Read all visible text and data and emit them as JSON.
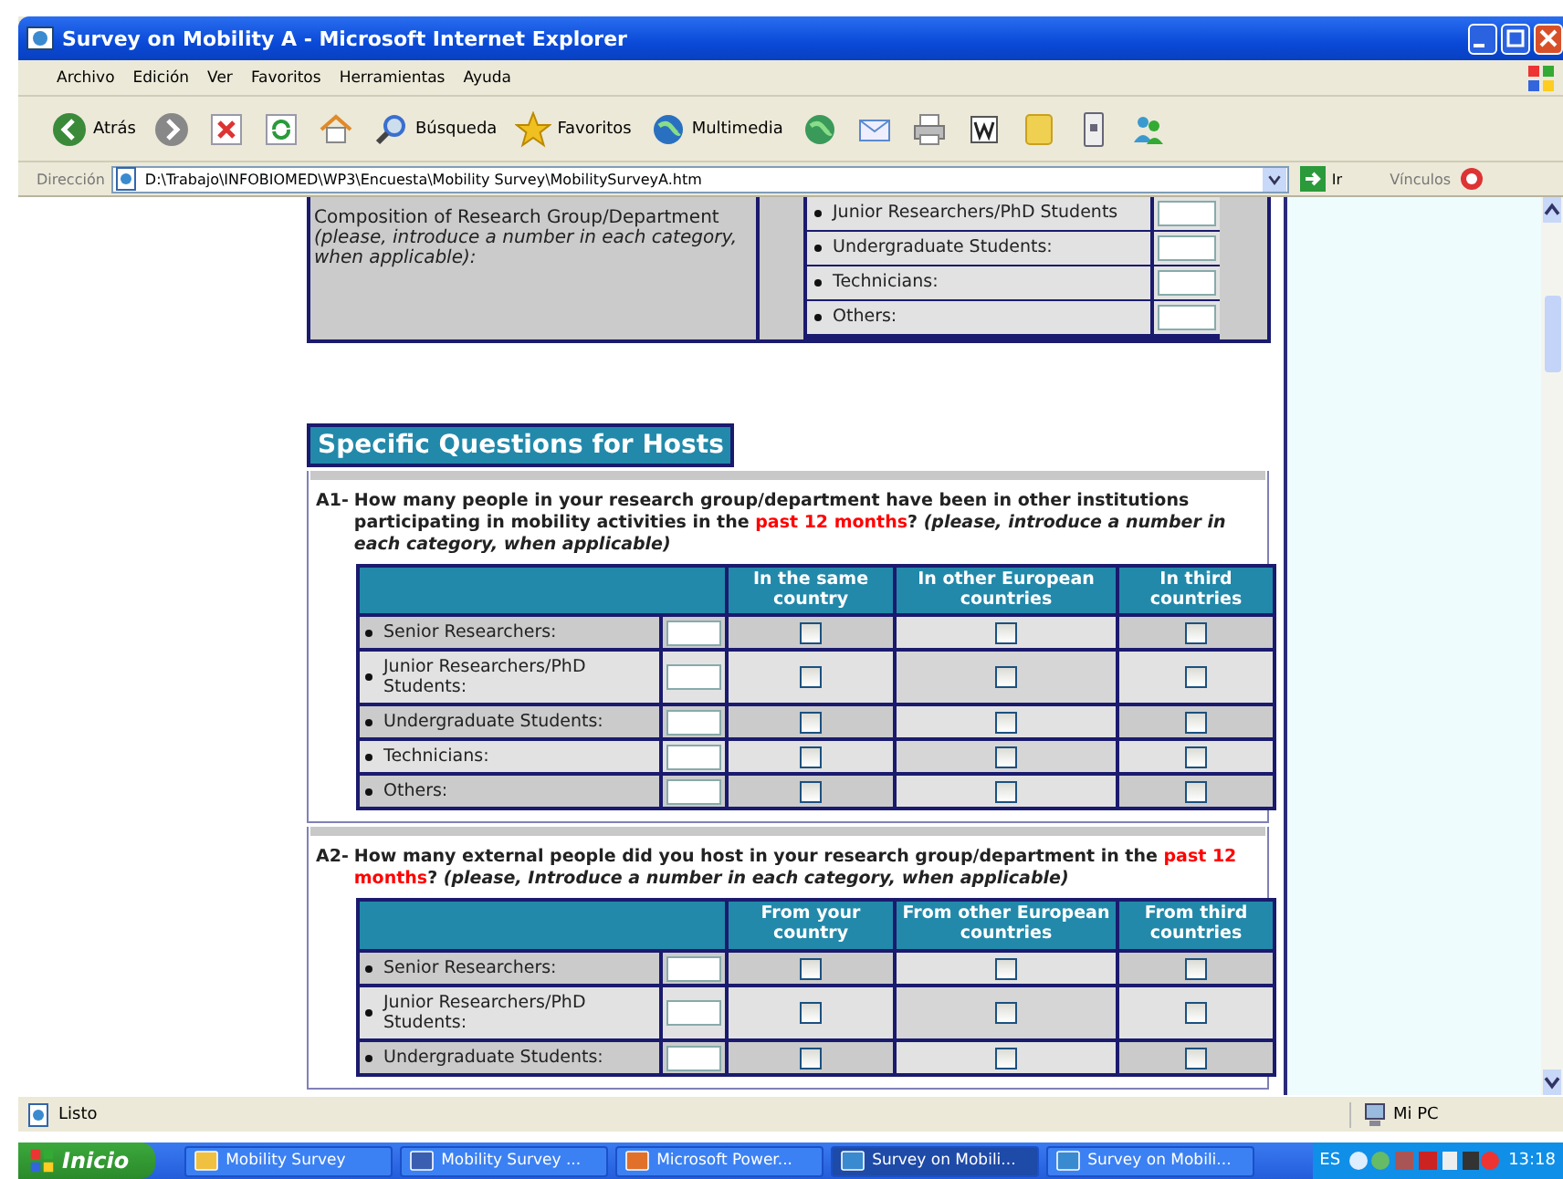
{
  "window": {
    "title": "Survey on Mobility A - Microsoft Internet Explorer"
  },
  "menu": [
    "Archivo",
    "Edición",
    "Ver",
    "Favoritos",
    "Herramientas",
    "Ayuda"
  ],
  "toolbar": [
    {
      "kind": "back",
      "label": "Atrás"
    },
    {
      "kind": "forward"
    },
    {
      "kind": "stop"
    },
    {
      "kind": "refresh"
    },
    {
      "kind": "home"
    },
    {
      "kind": "search",
      "label": "Búsqueda"
    },
    {
      "kind": "favorites",
      "label": "Favoritos"
    },
    {
      "kind": "media",
      "label": "Multimedia"
    },
    {
      "kind": "history"
    },
    {
      "kind": "mail"
    },
    {
      "kind": "print"
    },
    {
      "kind": "edit"
    },
    {
      "kind": "note"
    },
    {
      "kind": "device"
    },
    {
      "kind": "people"
    }
  ],
  "address": {
    "label": "Dirección",
    "value": "D:\\Trabajo\\INFOBIOMED\\WP3\\Encuesta\\Mobility Survey\\MobilitySurveyA.htm",
    "go": "Ir",
    "links": "Vínculos"
  },
  "composition": {
    "label": "Composition of Research Group/Department",
    "note": "(please, introduce a number in each category, when applicable):",
    "items": [
      "Junior Researchers/PhD Students",
      "Undergraduate Students:",
      "Technicians:",
      "Others:"
    ]
  },
  "section": {
    "title": "Specific Questions for Hosts"
  },
  "questions": [
    {
      "number": "A1-",
      "parts": [
        {
          "kind": "plain",
          "text": "How many people in your research group/department have been in other institutions participating in mobility activities in the "
        },
        {
          "kind": "highlight",
          "text": "past 12 months"
        },
        {
          "kind": "plain",
          "text": "? "
        },
        {
          "kind": "note",
          "text": "(please, introduce a number in each category, when applicable)"
        }
      ],
      "columns": [
        "In the same country",
        "In other European countries",
        "In third countries"
      ],
      "rows": [
        {
          "label": "Senior Researchers:",
          "checks": [
            {
              "checked": false
            },
            {
              "checked": false
            },
            {
              "checked": false
            }
          ]
        },
        {
          "label": "Junior Researchers/PhD Students:",
          "checks": [
            {
              "checked": false
            },
            {
              "checked": false
            },
            {
              "checked": false
            }
          ]
        },
        {
          "label": "Undergraduate Students:",
          "checks": [
            {
              "checked": false
            },
            {
              "checked": false
            },
            {
              "checked": false
            }
          ]
        },
        {
          "label": "Technicians:",
          "checks": [
            {
              "checked": false
            },
            {
              "checked": false
            },
            {
              "checked": false
            }
          ]
        },
        {
          "label": "Others:",
          "checks": [
            {
              "checked": false
            },
            {
              "checked": false
            },
            {
              "checked": false
            }
          ]
        }
      ]
    },
    {
      "number": "A2-",
      "parts": [
        {
          "kind": "plain",
          "text": "How many external people did you host in your research group/department in the "
        },
        {
          "kind": "highlight",
          "text": "past 12 months"
        },
        {
          "kind": "plain",
          "text": "? "
        },
        {
          "kind": "note",
          "text": "(please, Introduce a number in each category, when applicable)"
        }
      ],
      "columns": [
        "From your country",
        "From other European countries",
        "From third countries"
      ],
      "rows": [
        {
          "label": "Senior Researchers:",
          "checks": [
            {
              "checked": false
            },
            {
              "checked": false
            },
            {
              "checked": false
            }
          ]
        },
        {
          "label": "Junior Researchers/PhD Students:",
          "checks": [
            {
              "checked": false
            },
            {
              "checked": false
            },
            {
              "checked": false
            }
          ]
        },
        {
          "label": "Undergraduate Students:",
          "checks": [
            {
              "checked": false
            },
            {
              "checked": false
            },
            {
              "checked": false
            }
          ]
        }
      ]
    }
  ],
  "status_bar": {
    "text": "Listo",
    "zone": "Mi PC"
  },
  "taskbar": {
    "start": "Inicio",
    "tasks": [
      {
        "kind": "folder",
        "label": "Mobility Survey",
        "selected": false
      },
      {
        "kind": "doc",
        "label": "Mobility Survey ...",
        "selected": false
      },
      {
        "kind": "slides",
        "label": "Microsoft Power...",
        "selected": false
      },
      {
        "kind": "browser",
        "label": "Survey on Mobili...",
        "selected": true
      },
      {
        "kind": "browser",
        "label": "Survey on Mobili...",
        "selected": false
      }
    ],
    "language": "ES",
    "clock": "13:18"
  }
}
